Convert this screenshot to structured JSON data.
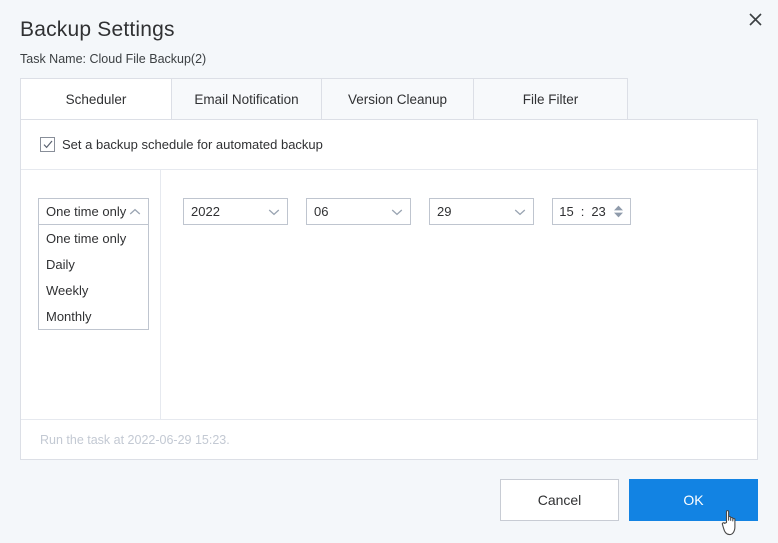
{
  "dialog": {
    "title": "Backup Settings",
    "task_name_label": "Task Name:",
    "task_name_value": "Cloud File Backup(2)",
    "close_icon": "close-icon"
  },
  "tabs": [
    {
      "label": "Scheduler",
      "active": true
    },
    {
      "label": "Email Notification",
      "active": false
    },
    {
      "label": "Version Cleanup",
      "active": false
    },
    {
      "label": "File Filter",
      "active": false
    }
  ],
  "scheduler": {
    "checkbox": {
      "label": "Set a backup schedule for automated backup",
      "checked": true,
      "icon": "check-icon"
    },
    "frequency": {
      "selected": "One time only",
      "expanded": true,
      "arrow_icon": "chevron-up-icon",
      "options": [
        "One time only",
        "Daily",
        "Weekly",
        "Monthly"
      ]
    },
    "date": {
      "year": "2022",
      "month": "06",
      "day": "29",
      "arrow_icon": "chevron-down-icon"
    },
    "time": {
      "hour": "15",
      "separator": ":",
      "minute": "23",
      "spinner_icon": "spinner-updown-icon"
    },
    "note": "Run the task at 2022-06-29 15:23."
  },
  "actions": {
    "cancel_label": "Cancel",
    "ok_label": "OK"
  },
  "colors": {
    "background": "#f4f7fa",
    "panel": "#ffffff",
    "border": "#dcdfe6",
    "primary": "#1283e3",
    "text": "#303133",
    "muted": "#c3c9d3"
  },
  "cursor": {
    "icon": "pointer-hand-cursor"
  }
}
